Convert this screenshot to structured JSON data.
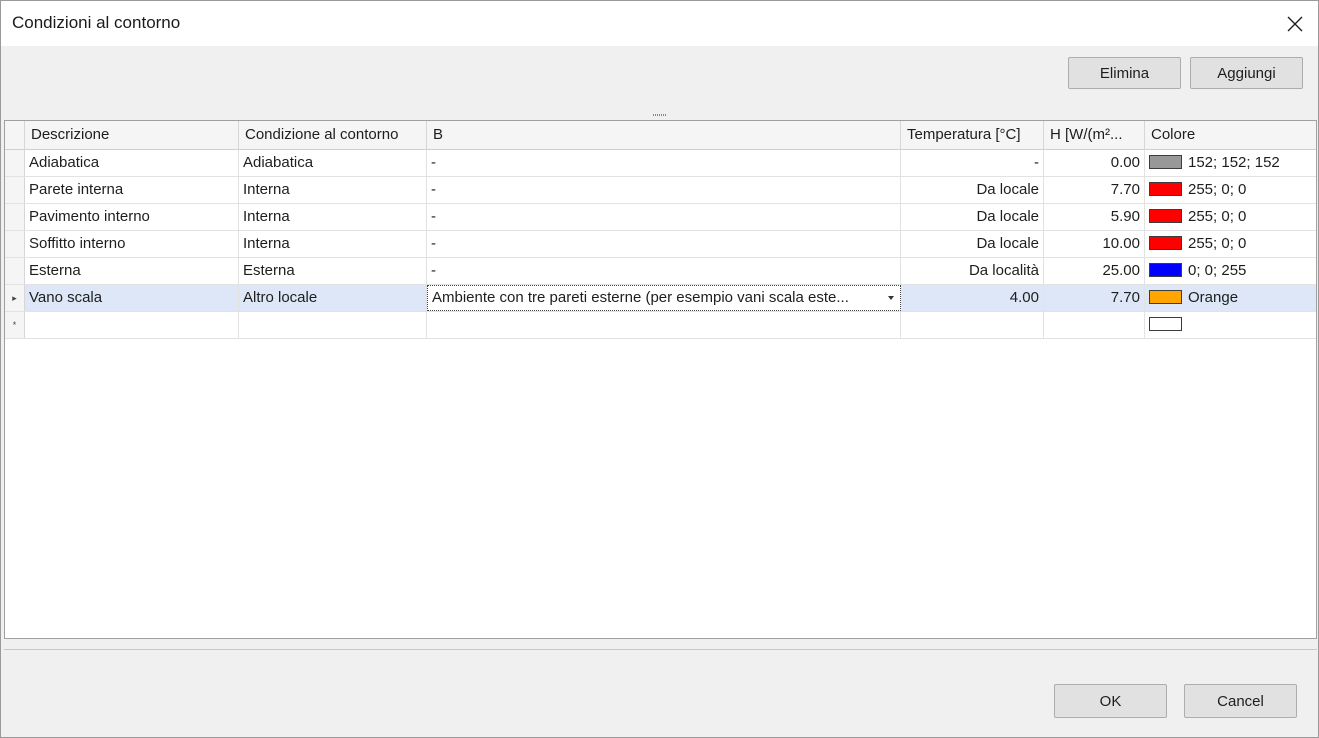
{
  "window": {
    "title": "Condizioni al contorno"
  },
  "toolbar": {
    "delete_label": "Elimina",
    "add_label": "Aggiungi"
  },
  "grid": {
    "columns": [
      "Descrizione",
      "Condizione al contorno",
      "B",
      "Temperatura [°C]",
      "H [W/(m²...",
      "Colore"
    ],
    "rows": [
      {
        "descrizione": "Adiabatica",
        "condizione": "Adiabatica",
        "b": "-",
        "temperatura": "-",
        "h": "0.00",
        "colore_label": "152; 152; 152",
        "colore_hex": "#989898"
      },
      {
        "descrizione": "Parete interna",
        "condizione": "Interna",
        "b": "-",
        "temperatura": "Da locale",
        "h": "7.70",
        "colore_label": "255; 0; 0",
        "colore_hex": "#ff0000"
      },
      {
        "descrizione": "Pavimento interno",
        "condizione": "Interna",
        "b": "-",
        "temperatura": "Da locale",
        "h": "5.90",
        "colore_label": "255; 0; 0",
        "colore_hex": "#ff0000"
      },
      {
        "descrizione": "Soffitto interno",
        "condizione": "Interna",
        "b": "-",
        "temperatura": "Da locale",
        "h": "10.00",
        "colore_label": "255; 0; 0",
        "colore_hex": "#ff0000"
      },
      {
        "descrizione": "Esterna",
        "condizione": "Esterna",
        "b": "-",
        "temperatura": "Da località",
        "h": "25.00",
        "colore_label": "0; 0; 255",
        "colore_hex": "#0000ff"
      },
      {
        "descrizione": "Vano scala",
        "condizione": "Altro locale",
        "b": "Ambiente con tre pareti esterne (per esempio vani scala este...",
        "temperatura": "4.00",
        "h": "7.70",
        "colore_label": "Orange",
        "colore_hex": "#ffa500"
      }
    ],
    "current_row_marker": "▸",
    "new_row_marker": "*",
    "new_row_color_hex": "#ffffff"
  },
  "footer": {
    "ok_label": "OK",
    "cancel_label": "Cancel"
  },
  "colors": {
    "selected_row": "#dde7f7",
    "window_bg": "#f0f0f0"
  },
  "icons": {
    "close": "close-icon",
    "dropdown": "chevron-down-icon"
  }
}
